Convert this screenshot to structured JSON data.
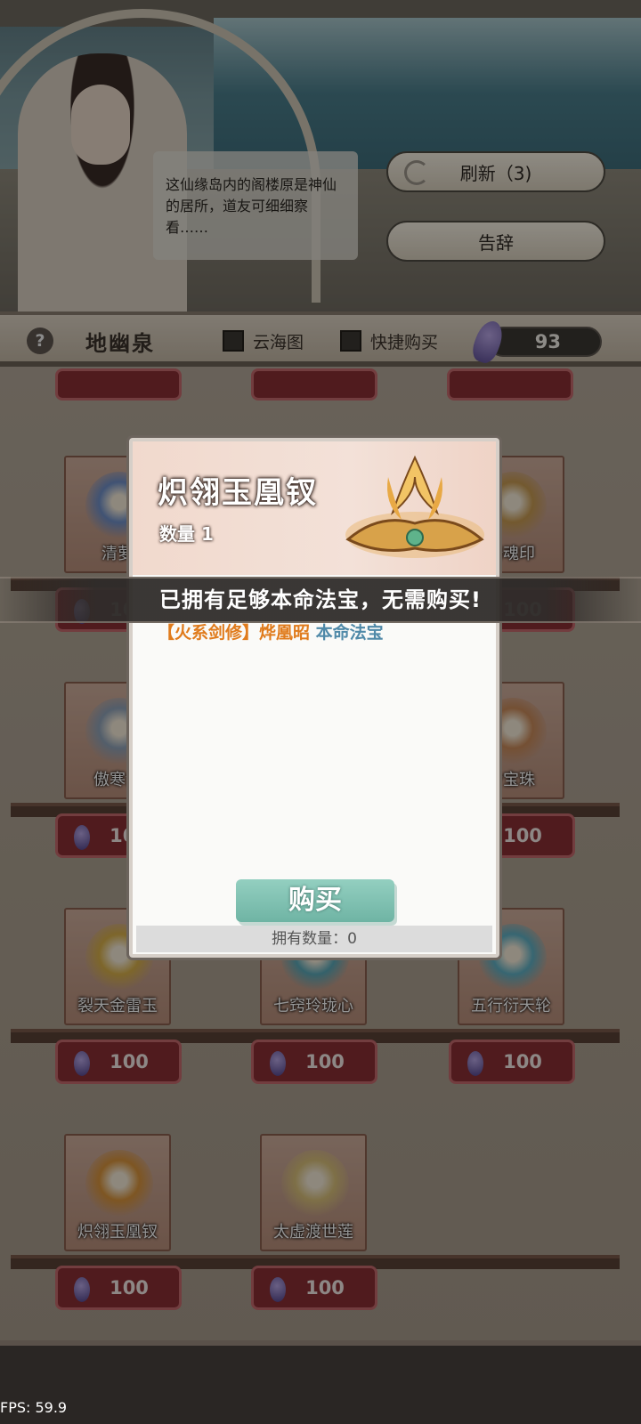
{
  "header": {
    "dialogue": "这仙缘岛内的阁楼原是神仙的居所，道友可细细察看……",
    "refresh_label": "刷新（3)",
    "leave_label": "告辞"
  },
  "shopbar": {
    "help_icon": "?",
    "shop_name": "地幽泉",
    "option1_label": "云海图",
    "option2_label": "快捷购买",
    "currency_amount": "93"
  },
  "items": [
    {
      "name": "清萝",
      "price": "100",
      "color": "#6f8fc8"
    },
    {
      "name": "",
      "price": "",
      "color": "#8a7fb0"
    },
    {
      "name": "铸魂印",
      "price": "100",
      "color": "#c79a52"
    },
    {
      "name": "傲寒剑",
      "price": "100",
      "color": "#8fa2b8"
    },
    {
      "name": "",
      "price": "",
      "color": "#8b8b8b"
    },
    {
      "name": "玲宝珠",
      "price": "100",
      "color": "#c98a5a"
    },
    {
      "name": "裂天金雷玉",
      "price": "100",
      "color": "#d8b04a"
    },
    {
      "name": "七窍玲珑心",
      "price": "100",
      "color": "#5aa8b8"
    },
    {
      "name": "五行衍天轮",
      "price": "100",
      "color": "#5fb0c4"
    },
    {
      "name": "炽翎玉凰钗",
      "price": "100",
      "color": "#d9943c"
    },
    {
      "name": "太虚渡世莲",
      "price": "100",
      "color": "#d9c07a"
    }
  ],
  "modal": {
    "title": "炽翎玉凰钗",
    "quantity": "数量 1",
    "tag_part1": "【火系剑修】烨凰昭",
    "tag_part2": " 本命法宝",
    "buy_label": "购买",
    "owned_label": "拥有数量：0"
  },
  "toast": "已拥有足够本命法宝，无需购买!",
  "fps": "FPS: 59.9"
}
